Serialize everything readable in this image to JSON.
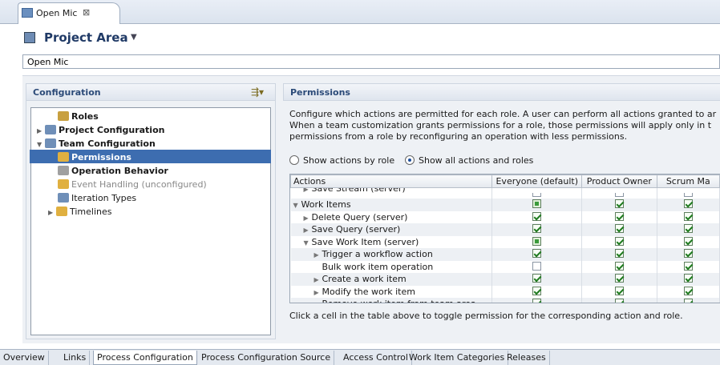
{
  "editor_tab": {
    "label": "Open Mic",
    "close": "⊠"
  },
  "header": {
    "title": "Project Area",
    "chevron": "▼"
  },
  "name_field": {
    "value": "Open Mic"
  },
  "configuration": {
    "title": "Configuration",
    "tree": [
      {
        "label": "Roles",
        "bold": true,
        "expander": "",
        "icon": "roles-icon",
        "color": "#c8a040"
      },
      {
        "label": "Project Configuration",
        "bold": true,
        "expander": "▶",
        "icon": "project-config-icon",
        "color": "#6f8fb8"
      },
      {
        "label": "Team Configuration",
        "bold": true,
        "expander": "▼",
        "icon": "team-config-icon",
        "color": "#6f8fb8"
      },
      {
        "label": "Permissions",
        "bold": true,
        "expander": "",
        "icon": "permissions-icon",
        "color": "#e0b040",
        "selected": true
      },
      {
        "label": "Operation Behavior",
        "bold": true,
        "expander": "",
        "icon": "operation-behavior-icon",
        "color": "#a0a0a0"
      },
      {
        "label": "Event Handling (unconfigured)",
        "bold": false,
        "dim": true,
        "expander": "",
        "icon": "event-handling-icon",
        "color": "#e0b040"
      },
      {
        "label": "Iteration Types",
        "bold": false,
        "expander": "",
        "icon": "iteration-types-icon",
        "color": "#6f8fb8"
      },
      {
        "label": "Timelines",
        "bold": false,
        "expander": "▶",
        "icon": "timelines-icon",
        "color": "#e0b040"
      }
    ]
  },
  "permissions": {
    "title": "Permissions",
    "description": [
      "Configure which actions are permitted for each role. A user can perform all actions granted to ar",
      "When a team customization grants permissions for a role, those permissions will apply only in t",
      "permissions from a role by reconfiguring an operation with less permissions."
    ],
    "radio_by_role": "Show actions by role",
    "radio_all": "Show all actions and roles",
    "columns": [
      "Actions",
      "Everyone (default)",
      "Product Owner",
      "Scrum Ma"
    ],
    "rows": [
      {
        "label": "Save Stream (server)",
        "indent": 1,
        "expander": "▶",
        "cells": [
          "empty",
          "empty",
          "empty"
        ],
        "cut": true
      },
      {
        "label": "Work Items",
        "indent": 0,
        "expander": "▼",
        "cells": [
          "part",
          "chk",
          "chk"
        ]
      },
      {
        "label": "Delete Query (server)",
        "indent": 1,
        "expander": "▶",
        "cells": [
          "chk",
          "chk",
          "chk"
        ]
      },
      {
        "label": "Save Query (server)",
        "indent": 1,
        "expander": "▶",
        "cells": [
          "chk",
          "chk",
          "chk"
        ]
      },
      {
        "label": "Save Work Item (server)",
        "indent": 1,
        "expander": "▼",
        "cells": [
          "part",
          "chk",
          "chk"
        ]
      },
      {
        "label": "Trigger a workflow action",
        "indent": 2,
        "expander": "▶",
        "cells": [
          "chk",
          "chk",
          "chk"
        ]
      },
      {
        "label": "Bulk work item operation",
        "indent": 2,
        "expander": "",
        "cells": [
          "empty",
          "chk",
          "chk"
        ]
      },
      {
        "label": "Create a work item",
        "indent": 2,
        "expander": "▶",
        "cells": [
          "chk",
          "chk",
          "chk"
        ]
      },
      {
        "label": "Modify the work item",
        "indent": 2,
        "expander": "▶",
        "cells": [
          "chk",
          "chk",
          "chk"
        ]
      },
      {
        "label": "Remove work item from team area",
        "indent": 2,
        "expander": "",
        "cells": [
          "chk",
          "chk",
          "chk"
        ]
      }
    ],
    "hint": "Click a cell in the table above to toggle permission for the corresponding action and role."
  },
  "bottom_tabs": [
    {
      "label": "Overview"
    },
    {
      "label": "Links"
    },
    {
      "label": "Process Configuration",
      "active": true
    },
    {
      "label": "Process Configuration Source"
    },
    {
      "label": "Access Control"
    },
    {
      "label": "Work Item Categories"
    },
    {
      "label": "Releases"
    }
  ]
}
